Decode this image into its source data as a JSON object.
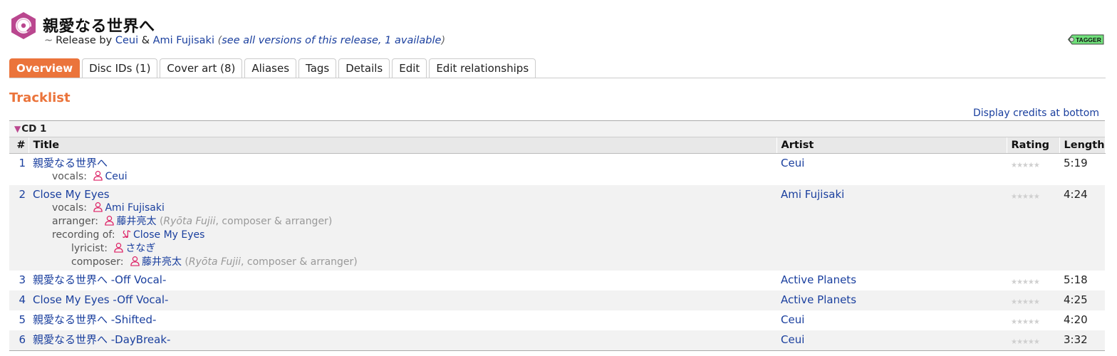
{
  "release": {
    "title": "親愛なる世界へ",
    "tilde": "~",
    "release_by": "Release by",
    "artist1": "Ceui",
    "amp": "&",
    "artist2": "Ami Fujisaki",
    "versions_open": "(",
    "versions_link": "see all versions of this release, 1 available",
    "versions_close": ")",
    "tagger_label": "TAGGER"
  },
  "tabs": [
    "Overview",
    "Disc IDs (1)",
    "Cover art (8)",
    "Aliases",
    "Tags",
    "Details",
    "Edit",
    "Edit relationships"
  ],
  "section_title": "Tracklist",
  "credits_toggle": "Display credits at bottom",
  "medium": "CD 1",
  "columns": {
    "num": "#",
    "title": "Title",
    "artist": "Artist",
    "rating": "Rating",
    "length": "Length"
  },
  "tracks": [
    {
      "num": "1",
      "title": "親愛なる世界へ",
      "artist": "Ceui",
      "length": "5:19",
      "credits": [
        {
          "role": "vocals:",
          "name": "Ceui",
          "note_pre": "",
          "note_it": "",
          "note_post": ""
        }
      ]
    },
    {
      "num": "2",
      "title": "Close My Eyes",
      "artist": "Ami Fujisaki",
      "length": "4:24",
      "credits": [
        {
          "role": "vocals:",
          "name": "Ami Fujisaki"
        },
        {
          "role": "arranger:",
          "name": "藤井亮太",
          "note_pre": "(",
          "note_it": "Ryōta Fujii",
          "note_post": ", composer & arranger)"
        },
        {
          "role": "recording of:",
          "name": "Close My Eyes"
        },
        {
          "role": "lyricist:",
          "name": "さなぎ"
        },
        {
          "role": "composer:",
          "name": "藤井亮太",
          "note_pre": "(",
          "note_it": "Ryōta Fujii",
          "note_post": ", composer & arranger)"
        }
      ]
    },
    {
      "num": "3",
      "title": "親愛なる世界へ -Off Vocal-",
      "artist": "Active Planets",
      "length": "5:18"
    },
    {
      "num": "4",
      "title": "Close My Eyes -Off Vocal-",
      "artist": "Active Planets",
      "length": "4:25"
    },
    {
      "num": "5",
      "title": "親愛なる世界へ -Shifted-",
      "artist": "Ceui",
      "length": "4:20"
    },
    {
      "num": "6",
      "title": "親愛なる世界へ -DayBreak-",
      "artist": "Ceui",
      "length": "3:32"
    }
  ],
  "rating_stars": "★★★★★",
  "colors": {
    "accent": "#eb743b",
    "link": "#1a3f9e",
    "logo": "#ba478f",
    "tagger": "#6fe07a"
  },
  "icons": {
    "logo": "release-disc-icon",
    "artist": "artist-person-icon",
    "work": "work-music-icon",
    "tagger": "tagger-icon"
  }
}
